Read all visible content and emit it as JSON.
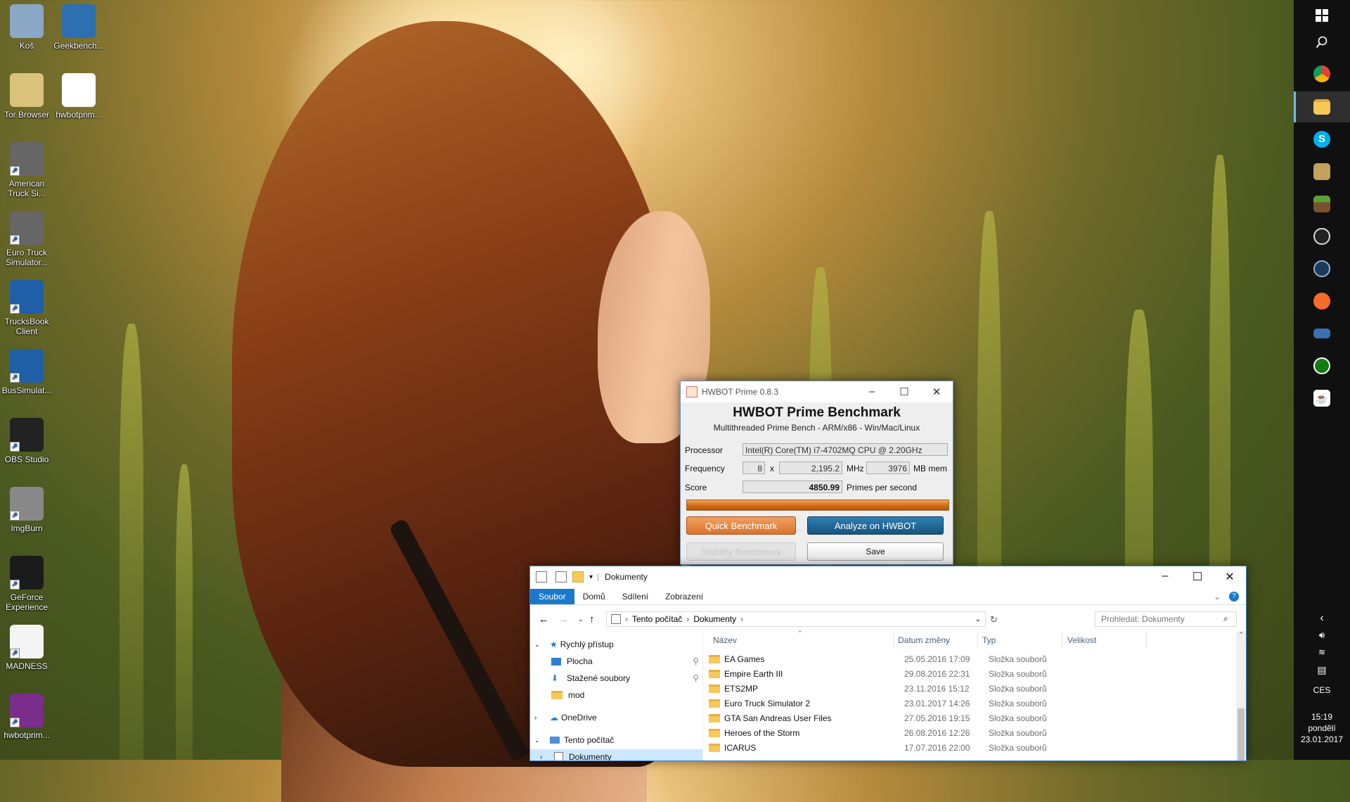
{
  "desktop_icons": [
    {
      "label": "Koš",
      "icon": "recycle-bin-icon"
    },
    {
      "label": "Geekbench...",
      "icon": "geekbench-icon"
    },
    {
      "label": "Tor Browser",
      "icon": "tor-browser-icon"
    },
    {
      "label": "hwbotprim...",
      "icon": "java-icon"
    },
    {
      "label": "American Truck Si...",
      "icon": "ats-icon"
    },
    {
      "label": "Euro Truck Simulator...",
      "icon": "ets2-icon"
    },
    {
      "label": "TrucksBook Client",
      "icon": "trucksbook-icon"
    },
    {
      "label": "BusSimulat...",
      "icon": "bussim-icon"
    },
    {
      "label": "OBS Studio",
      "icon": "obs-icon"
    },
    {
      "label": "ImgBurn",
      "icon": "imgburn-icon"
    },
    {
      "label": "GeForce Experience",
      "icon": "geforce-icon"
    },
    {
      "label": "MADNESS",
      "icon": "document-icon"
    },
    {
      "label": "hwbotprim...",
      "icon": "winrar-icon"
    }
  ],
  "taskbar": {
    "tray_lang": "CES",
    "time": "15:19",
    "day": "pondělí",
    "date": "23.01.2017"
  },
  "hwbot": {
    "window_title": "HWBOT Prime 0.8.3",
    "heading": "HWBOT Prime Benchmark",
    "subheading": "Multithreaded Prime Bench - ARM/x86 - Win/Mac/Linux",
    "processor_label": "Processor",
    "processor_value": "Intel(R) Core(TM) i7-4702MQ CPU @ 2.20GHz",
    "frequency_label": "Frequency",
    "cores": "8",
    "times": "x",
    "mhz_value": "2,195.2",
    "mhz_unit": "MHz",
    "mem_value": "3976",
    "mem_unit": "MB mem",
    "score_label": "Score",
    "score_value": "4850.99",
    "score_unit": "Primes per second",
    "progress": 1.0,
    "quick_btn": "Quick Benchmark",
    "analyze_btn": "Analyze on HWBOT",
    "stability_btn": "Stability Benchmark",
    "save_btn": "Save",
    "accent": "#e07a2c",
    "analyze_color": "#1c5f8f"
  },
  "explorer": {
    "title": "Dokumenty",
    "ribbon": [
      "Soubor",
      "Domů",
      "Sdílení",
      "Zobrazení"
    ],
    "breadcrumb": [
      "Tento počítač",
      "Dokumenty"
    ],
    "search_placeholder": "Prohledat: Dokumenty",
    "nav": [
      {
        "label": "Rychlý přístup",
        "icon": "star-icon"
      },
      {
        "label": "Plocha",
        "icon": "desktop-icon"
      },
      {
        "label": "Stažené soubory",
        "icon": "download-icon"
      },
      {
        "label": "mod",
        "icon": "folder-icon"
      },
      {
        "label": "OneDrive",
        "icon": "cloud-icon"
      },
      {
        "label": "Tento počítač",
        "icon": "computer-icon"
      },
      {
        "label": "Dokumenty",
        "icon": "documents-icon"
      }
    ],
    "columns": [
      "Název",
      "Datum změny",
      "Typ",
      "Velikost"
    ],
    "rows": [
      {
        "name": "EA Games",
        "date": "25.05.2016 17:09",
        "type": "Složka souborů"
      },
      {
        "name": "Empire Earth III",
        "date": "29.08.2016 22:31",
        "type": "Složka souborů"
      },
      {
        "name": "ETS2MP",
        "date": "23.11.2016 15:12",
        "type": "Složka souborů"
      },
      {
        "name": "Euro Truck Simulator 2",
        "date": "23.01.2017 14:26",
        "type": "Složka souborů"
      },
      {
        "name": "GTA San Andreas User Files",
        "date": "27.05.2016 19:15",
        "type": "Složka souborů"
      },
      {
        "name": "Heroes of the Storm",
        "date": "26.08.2016 12:26",
        "type": "Složka souborů"
      },
      {
        "name": "ICARUS",
        "date": "17.07.2016 22:00",
        "type": "Složka souborů"
      }
    ]
  }
}
